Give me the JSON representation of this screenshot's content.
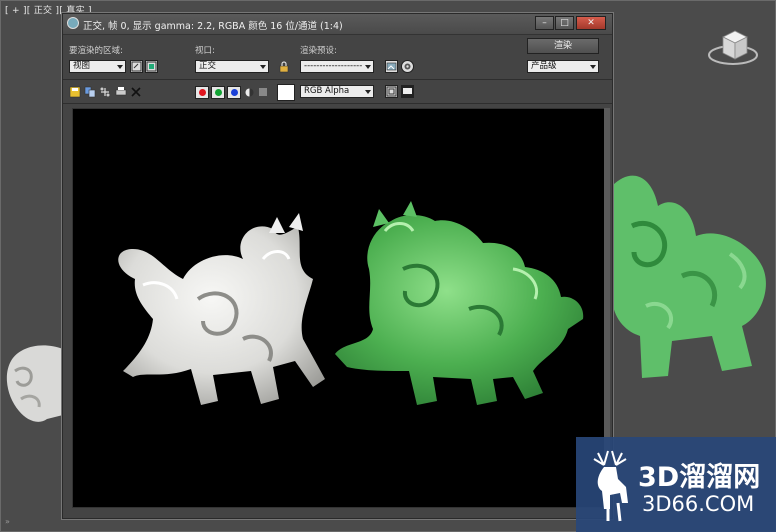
{
  "viewport": {
    "label": "[ + ][ 正交 ][ 真实 ]"
  },
  "window": {
    "title": "正交, 帧 0, 显示 gamma: 2.2, RGBA 颜色 16 位/通道 (1:4)",
    "buttons": [
      "minimize",
      "maximize",
      "close"
    ]
  },
  "controls": {
    "area_label": "要渲染的区域:",
    "area_value": "视图",
    "viewport_label": "视口:",
    "viewport_value": "正交",
    "preset_label": "渲染预设:",
    "preset_value": "-------------------",
    "render_button": "渲染",
    "quality_value": "产品级",
    "channel_value": "RGB Alpha"
  },
  "colors": {
    "red": "#e0141e",
    "green": "#12a334",
    "blue": "#1a3fd6",
    "jade": "#4caf50",
    "white_statue": "#e8e8e6"
  },
  "watermark": {
    "line1": "3D溜溜网",
    "line2": "3D66.COM"
  }
}
